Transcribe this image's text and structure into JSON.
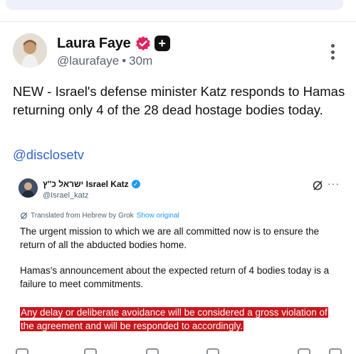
{
  "post": {
    "display_name": "Laura Faye",
    "handle": "@laurafaye",
    "separator": "•",
    "time": "30m",
    "plus_glyph": "+",
    "text": "NEW - Israel's defense minister Katz responds to Hamas returning only 4 of the 28 dead hostage bodies today.",
    "mention": "@disclosetv",
    "icons": {
      "verified": "verified-badge-icon",
      "plus": "plus-badge-icon",
      "more": "more-vertical-icon"
    }
  },
  "embedded": {
    "display_name": "ישראל כ\"ץ Israel Katz",
    "handle": "@Israel_katz",
    "more_glyph": "···",
    "check_glyph": "✓",
    "translated_label": "Translated from Hebrew by Grok",
    "show_original": "Show original",
    "paragraph1": "The urgent mission to which we are all committed now is to ensure the return of all the abducted bodies home.",
    "paragraph2": "Hamas's announcement about the expected return of 4 bodies today is a failure to meet commitments.",
    "paragraph3": "Any delay or deliberate avoidance will be considered a gross violation of the agreement and will be responded to accordingly.",
    "highlight_color": "#c8171d"
  },
  "colors": {
    "link": "#2f63d3",
    "verified": "#e0245e",
    "muted": "#5d6470"
  }
}
